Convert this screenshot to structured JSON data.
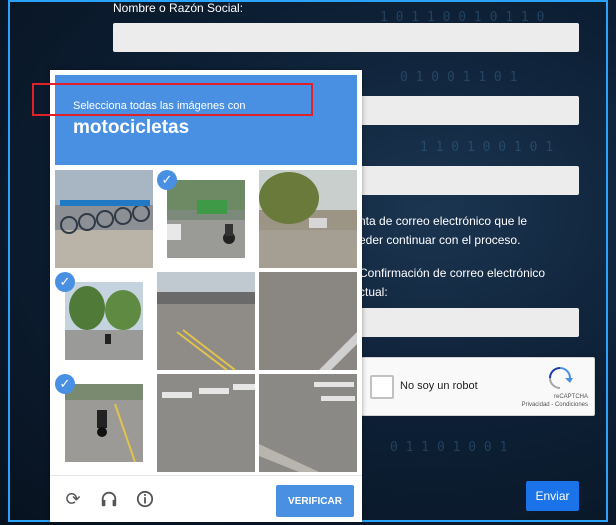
{
  "form": {
    "name_label": "Nombre o Razón Social:",
    "email_note_line1": "nta de correo electrónico que le",
    "email_note_line2": "eder continuar con el proceso.",
    "confirm_line1": "Confirmación de correo electrónico",
    "confirm_line2": "ctual:",
    "send_label": "Enviar"
  },
  "recaptcha": {
    "label": "No soy un robot",
    "brand": "reCAPTCHA",
    "links": "Privacidad - Condiciones"
  },
  "captcha": {
    "instruction": "Selecciona todas las imágenes con",
    "target_word": "motocicletas",
    "verify_label": "VERIFICAR",
    "selected_tiles": [
      2,
      4,
      7
    ]
  },
  "colors": {
    "accent": "#4a90e2",
    "send_button": "#1a73e8",
    "highlight": "#e0202a"
  }
}
